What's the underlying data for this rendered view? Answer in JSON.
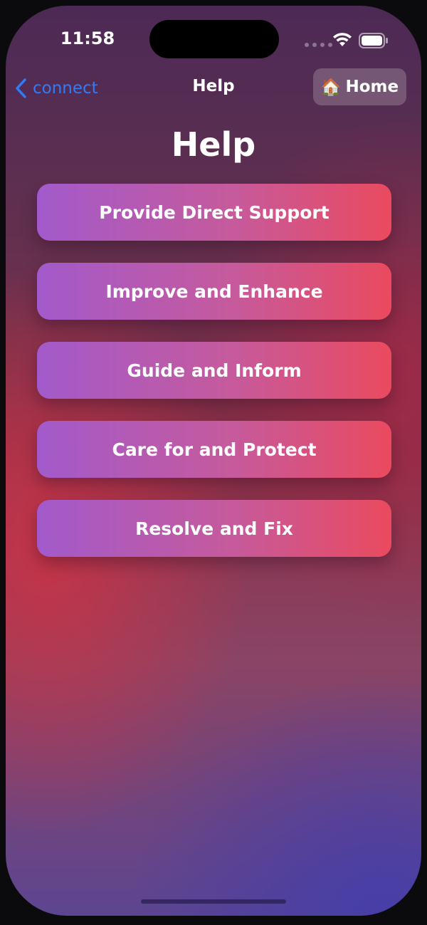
{
  "status_bar": {
    "time": "11:58",
    "icons": [
      "wifi-icon",
      "battery-icon"
    ]
  },
  "nav": {
    "back_label": "connect",
    "title": "Help",
    "home_emoji": "🏠",
    "home_label": "Home"
  },
  "page": {
    "title": "Help"
  },
  "menu": {
    "items": [
      {
        "label": "Provide Direct Support"
      },
      {
        "label": "Improve and Enhance"
      },
      {
        "label": "Guide and Inform"
      },
      {
        "label": "Care for and Protect"
      },
      {
        "label": "Resolve and Fix"
      }
    ]
  },
  "colors": {
    "accent_blue": "#2f7cf6",
    "button_gradient_start": "#a25acb",
    "button_gradient_end": "#ea4a5e"
  }
}
